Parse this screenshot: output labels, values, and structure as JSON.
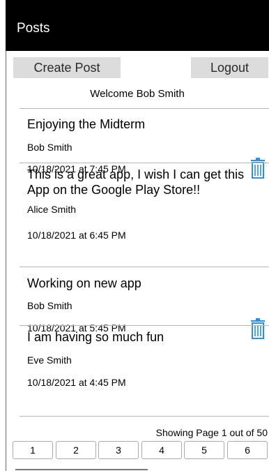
{
  "header": {
    "title": "Posts"
  },
  "toolbar": {
    "create_label": "Create Post",
    "logout_label": "Logout"
  },
  "welcome": "Welcome Bob Smith",
  "posts": [
    {
      "title": "Enjoying the Midterm",
      "author": "Bob Smith",
      "date": "10/18/2021 at 7:45 PM",
      "deletable": true
    },
    {
      "title": "This is a great app, I wish I can get this App on the Google Play Store!!",
      "author": "Alice Smith",
      "date": "10/18/2021 at 6:45 PM",
      "deletable": false
    },
    {
      "title": "Working on new app",
      "author": "Bob Smith",
      "date": "10/18/2021 at 5:45 PM",
      "deletable": true
    },
    {
      "title": "I am having so much fun",
      "author": "Eve Smith",
      "date": "10/18/2021 at 4:45 PM",
      "deletable": false
    }
  ],
  "pagination": {
    "status": "Showing Page 1 out of 50",
    "pages": [
      "1",
      "2",
      "3",
      "4",
      "5",
      "6"
    ]
  },
  "icons": {
    "delete": "trash-icon"
  },
  "colors": {
    "header_bg": "#000000",
    "button_bg": "#dcdcdc",
    "trash": "#2f8fd8"
  }
}
